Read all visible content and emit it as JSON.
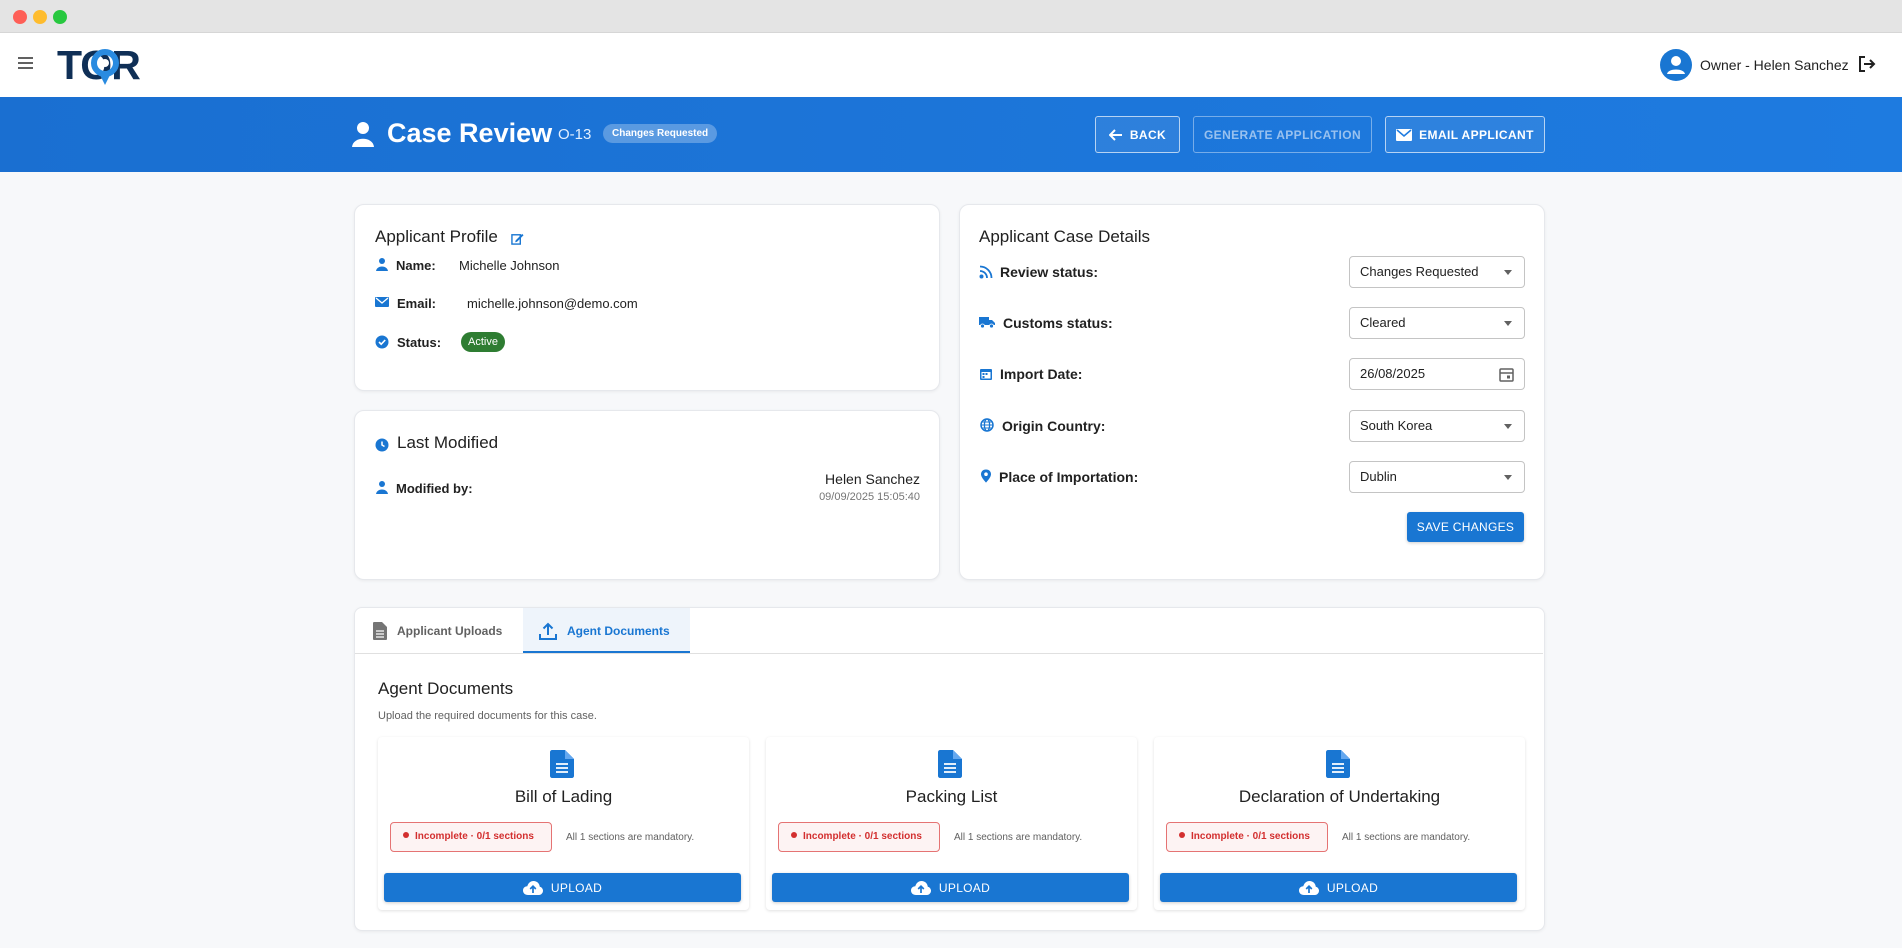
{
  "app": {
    "logo_text": "TOR",
    "user_label": "Owner - Helen Sanchez"
  },
  "header": {
    "title": "Case Review",
    "case_id": "O-13",
    "status_chip": "Changes Requested",
    "back_label": "BACK",
    "generate_label": "GENERATE APPLICATION",
    "email_label": "EMAIL APPLICANT"
  },
  "profile": {
    "title": "Applicant Profile",
    "name_label": "Name:",
    "name_value": "Michelle Johnson",
    "email_label": "Email:",
    "email_value": "michelle.johnson@demo.com",
    "status_label": "Status:",
    "status_value": "Active"
  },
  "last_modified": {
    "title": "Last Modified",
    "modified_by_label": "Modified by:",
    "modified_by_value": "Helen Sanchez",
    "modified_at": "09/09/2025 15:05:40"
  },
  "case_details": {
    "title": "Applicant Case Details",
    "review_status_label": "Review status:",
    "review_status_value": "Changes Requested",
    "customs_status_label": "Customs status:",
    "customs_status_value": "Cleared",
    "import_date_label": "Import Date:",
    "import_date_value": "26/08/2025",
    "origin_country_label": "Origin Country:",
    "origin_country_value": "South Korea",
    "place_label": "Place of Importation:",
    "place_value": "Dublin",
    "save_label": "SAVE CHANGES"
  },
  "tabs": {
    "uploads_label": "Applicant Uploads",
    "agent_label": "Agent Documents"
  },
  "agent_documents": {
    "title": "Agent Documents",
    "subtitle": "Upload the required documents for this case.",
    "documents": [
      {
        "name": "Bill of Lading",
        "status": "Incomplete · 0/1 sections",
        "note": "All 1 sections are mandatory.",
        "button": "UPLOAD"
      },
      {
        "name": "Packing List",
        "status": "Incomplete · 0/1 sections",
        "note": "All 1 sections are mandatory.",
        "button": "UPLOAD"
      },
      {
        "name": "Declaration of Undertaking",
        "status": "Incomplete · 0/1 sections",
        "note": "All 1 sections are mandatory.",
        "button": "UPLOAD"
      }
    ]
  },
  "colors": {
    "primary": "#1976d2",
    "header_blue": "#1e7be0",
    "active_green": "#2e7d32",
    "error_red": "#d32f2f",
    "logo_dark": "#0f2f56"
  },
  "icons": [
    "menu-icon",
    "user-icon",
    "logout-icon",
    "person-icon",
    "arrow-back-icon",
    "mail-icon",
    "edit-icon",
    "check-circle-icon",
    "clock-icon",
    "rss-icon",
    "truck-icon",
    "calendar-icon",
    "globe-icon",
    "location-pin-icon",
    "document-icon",
    "upload-tray-icon",
    "cloud-upload-icon"
  ]
}
